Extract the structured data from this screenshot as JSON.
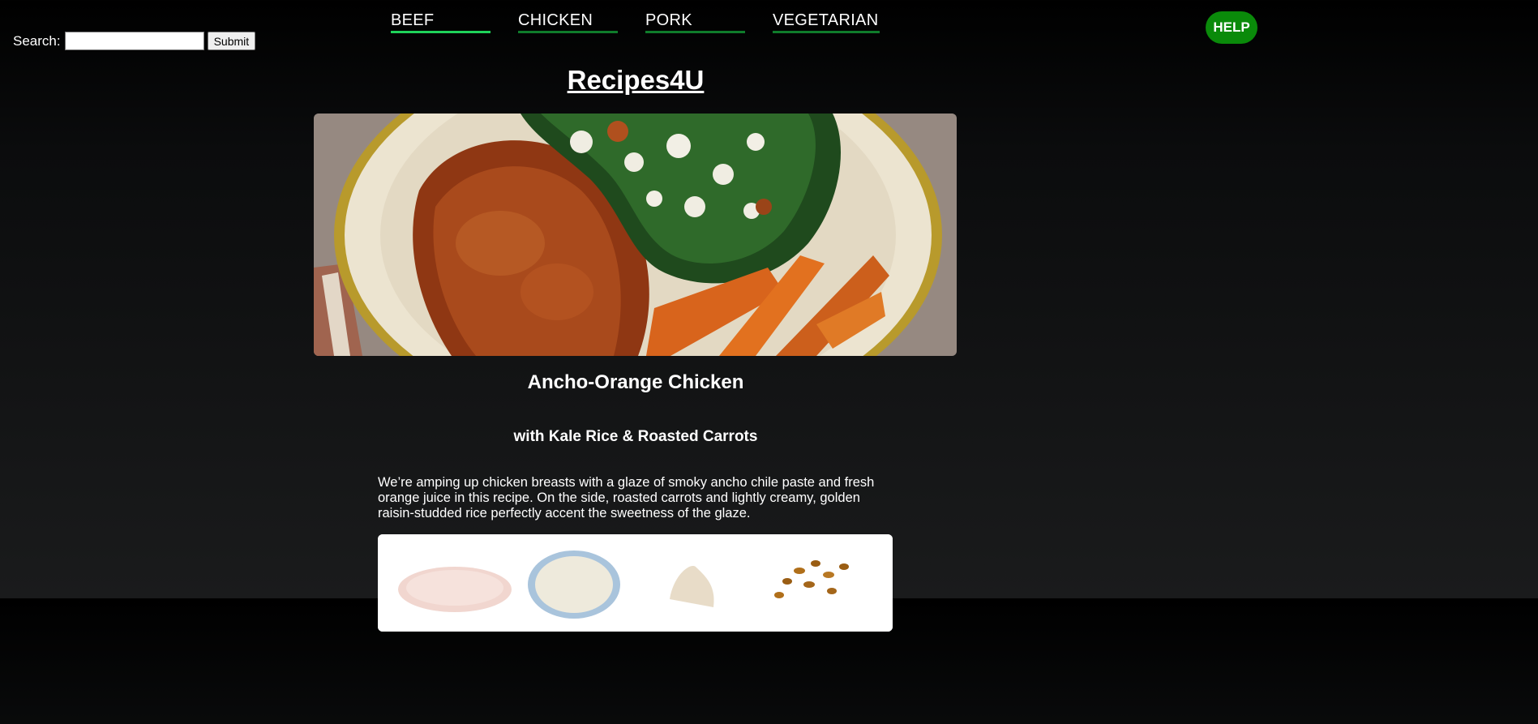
{
  "search": {
    "label": "Search:",
    "value": "",
    "placeholder": "",
    "submit_label": "Submit"
  },
  "nav": {
    "tabs": [
      {
        "label": "BEEF"
      },
      {
        "label": "CHICKEN"
      },
      {
        "label": "PORK"
      },
      {
        "label": "VEGETARIAN"
      }
    ]
  },
  "help": {
    "label": "HELP"
  },
  "site": {
    "title": "Recipes4U"
  },
  "recipe": {
    "title": "Ancho-Orange Chicken",
    "subtitle": "with Kale Rice & Roasted Carrots",
    "description": "We’re amping up chicken breasts with a glaze of smoky ancho chile paste and fresh orange juice in this recipe. On the side, roasted carrots and lightly creamy, golden raisin-studded rice perfectly accent the sweetness of the glaze."
  },
  "colors": {
    "nav_underline": "#0f7c2b",
    "nav_underline_active": "#1fd35a",
    "help_button": "#0a8a0a"
  }
}
